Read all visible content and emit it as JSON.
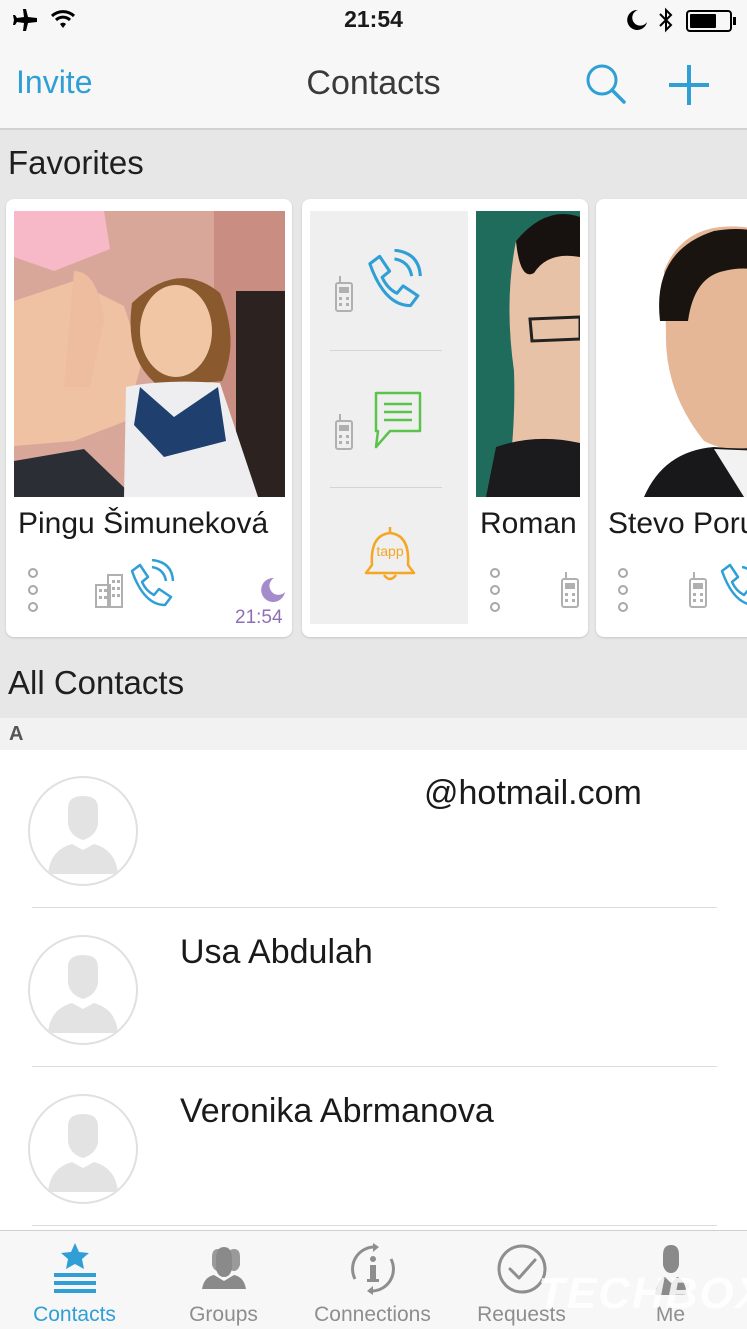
{
  "status_bar": {
    "time": "21:54"
  },
  "nav": {
    "invite_label": "Invite",
    "title": "Contacts"
  },
  "favorites": {
    "heading": "Favorites",
    "cards": [
      {
        "name": "Pingu Šimuneková",
        "status_time": "21:54"
      },
      {
        "name": "Roman"
      },
      {
        "name": "Stevo Poru"
      }
    ],
    "tapp_label": "tapp"
  },
  "all_contacts": {
    "heading": "All Contacts",
    "section_letter": "A",
    "rows": [
      {
        "name": "@hotmail.com"
      },
      {
        "name": "Usa Abdulah"
      },
      {
        "name": "Veronika Abrmanova"
      }
    ]
  },
  "tabbar": {
    "tabs": [
      {
        "label": "Contacts",
        "icon": "star-list-icon",
        "active": true
      },
      {
        "label": "Groups",
        "icon": "group-icon"
      },
      {
        "label": "Connections",
        "icon": "info-cycle-icon"
      },
      {
        "label": "Requests",
        "icon": "check-circle-icon"
      },
      {
        "label": "Me",
        "icon": "person-icon"
      }
    ]
  },
  "watermark": "TECHBOX",
  "colors": {
    "accent": "#2f9fd5",
    "message_green": "#5bc34b",
    "alarm_orange": "#f5a623",
    "moon_purple": "#a48bcb"
  }
}
